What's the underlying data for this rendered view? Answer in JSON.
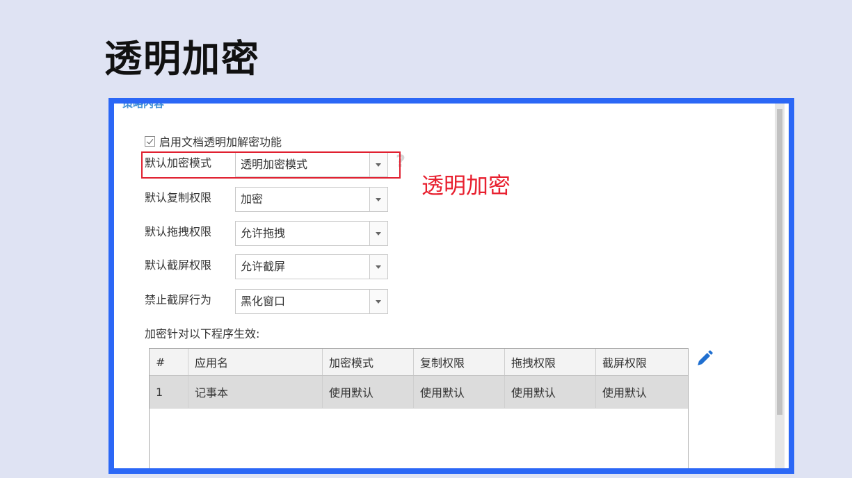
{
  "slide_title": "透明加密",
  "section": {
    "header_partial": "策略内容"
  },
  "enable_checkbox": {
    "label": "启用文档透明加解密功能",
    "checked": true
  },
  "fields": [
    {
      "label": "默认加密模式",
      "value": "透明加密模式"
    },
    {
      "label": "默认复制权限",
      "value": "加密"
    },
    {
      "label": "默认拖拽权限",
      "value": "允许拖拽"
    },
    {
      "label": "默认截屏权限",
      "value": "允许截屏"
    },
    {
      "label": "禁止截屏行为",
      "value": "黑化窗口"
    }
  ],
  "help_icon": "?",
  "annotation": {
    "text": "透明加密",
    "color": "#e8202f"
  },
  "scope_label": "加密针对以下程序生效:",
  "table": {
    "headers": [
      "#",
      "应用名",
      "加密模式",
      "复制权限",
      "拖拽权限",
      "截屏权限"
    ],
    "rows": [
      [
        "1",
        "记事本",
        "使用默认",
        "使用默认",
        "使用默认",
        "使用默认"
      ]
    ]
  },
  "icons": {
    "edit": "pencil-edit-icon",
    "help": "question-icon",
    "checkbox": "checkmark-icon"
  },
  "colors": {
    "frame": "#2b67f6",
    "highlight": "#e02030",
    "background": "#dfe3f3"
  }
}
